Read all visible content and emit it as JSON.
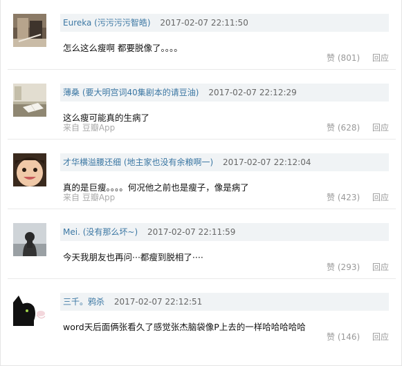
{
  "comments": [
    {
      "author": "Eureka",
      "author_note": "(污污污污智皓)",
      "time": "2017-02-07 22:11:50",
      "text": "怎么这么瘦啊 都要脱像了。。。。",
      "source": "",
      "like_label": "赞",
      "likes": "(801)",
      "reply_label": "回应",
      "avatar_icon": "photo-avatar-icon"
    },
    {
      "author": "薄桑",
      "author_note": "(要大明宫词40集剧本的请豆油)",
      "time": "2017-02-07 22:12:29",
      "text": "这么瘦可能真的生病了",
      "source": "来自 豆瓣App",
      "like_label": "赞",
      "likes": "(628)",
      "reply_label": "回应",
      "avatar_icon": "book-avatar-icon"
    },
    {
      "author": "才华横溢腰还细",
      "author_note": "(地主家也没有余粮啊一)",
      "time": "2017-02-07 22:12:04",
      "text": "真的是巨瘦。。。。何况他之前也是瘦子，像是病了",
      "source": "来自 豆瓣App",
      "like_label": "赞",
      "likes": "(423)",
      "reply_label": "回应",
      "avatar_icon": "child-face-avatar-icon"
    },
    {
      "author": "Mei.",
      "author_note": "(没有那么坏~)",
      "time": "2017-02-07 22:11:59",
      "text": "今天我朋友也再问···都瘦到脱相了····",
      "source": "",
      "like_label": "赞",
      "likes": "(293)",
      "reply_label": "回应",
      "avatar_icon": "person-back-avatar-icon"
    },
    {
      "author": "三千。鸦杀",
      "author_note": "",
      "time": "2017-02-07 22:12:51",
      "text": "word天后面俩张看久了感觉张杰脑袋像P上去的一样哈哈哈哈哈",
      "source": "",
      "like_label": "赞",
      "likes": "(146)",
      "reply_label": "回应",
      "avatar_icon": "black-cat-avatar-icon"
    }
  ],
  "colors": {
    "link": "#3b77a3",
    "header_bg": "#f0f3f5",
    "muted": "#999999"
  }
}
